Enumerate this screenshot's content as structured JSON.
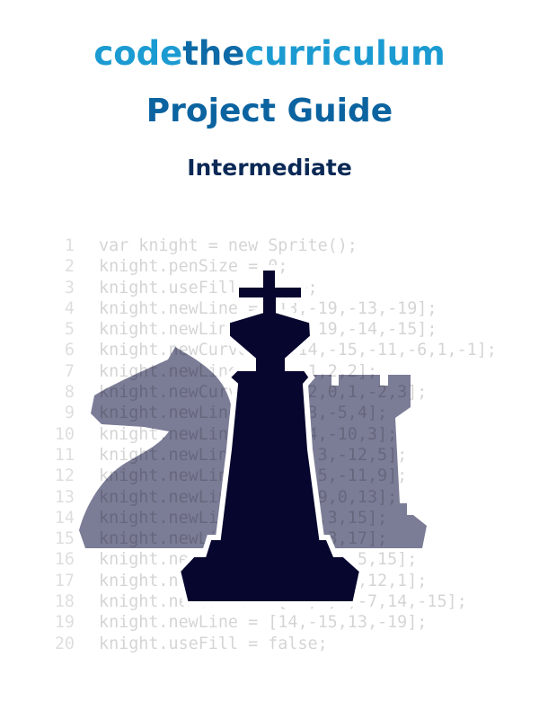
{
  "header": {
    "brand": [
      {
        "text": "code",
        "tone": "light"
      },
      {
        "text": "the",
        "tone": "dark"
      },
      {
        "text": "curriculum",
        "tone": "light"
      }
    ],
    "title": "Project Guide",
    "level": "Intermediate"
  },
  "colors": {
    "brand_light": "#1b9bd1",
    "brand_dark": "#0d6aa6",
    "title": "#0b63a0",
    "level": "#0b2956",
    "piece_grey": "#7b7c96",
    "king": "#07062e"
  },
  "illustration": {
    "pieces": [
      "knight-icon",
      "king-icon",
      "rook-icon"
    ]
  },
  "code": {
    "lines": [
      {
        "n": "1",
        "text": "var knight = new Sprite();"
      },
      {
        "n": "2",
        "text": "knight.penSize = 0;"
      },
      {
        "n": "3",
        "text": "knight.useFill = true;"
      },
      {
        "n": "4",
        "text": "knight.newLine = [13,-19,-13,-19];"
      },
      {
        "n": "5",
        "text": "knight.newLine = [13,-19,-14,-15];"
      },
      {
        "n": "6",
        "text": "knight.newCurve = [-14,-15,-11,-6,1,-1];"
      },
      {
        "n": "7",
        "text": "knight.newLine = [1,-1,2,2];"
      },
      {
        "n": "8",
        "text": "knight.newCurve = [2,2,0,1,-2,3];"
      },
      {
        "n": "9",
        "text": "knight.newLine = [-2,3,-5,4];"
      },
      {
        "n": "10",
        "text": "knight.newLine = [-5,4,-10,3];"
      },
      {
        "n": "11",
        "text": "knight.newLine = [-10,3,-12,5];"
      },
      {
        "n": "12",
        "text": "knight.newLine = [-12,5,-11,9];"
      },
      {
        "n": "13",
        "text": "knight.newLine = [-11,9,0,13];"
      },
      {
        "n": "14",
        "text": "knight.newLine = [0,13,3,15];"
      },
      {
        "n": "15",
        "text": "knight.newLine = [3,15,3,17];"
      },
      {
        "n": "16",
        "text": "knight.newLine = [3,17,16,5,15];"
      },
      {
        "n": "17",
        "text": "knight.newCurve = [16,5,12,12,1];"
      },
      {
        "n": "18",
        "text": "knight.newCurve = [12,1,8,-7,14,-15];"
      },
      {
        "n": "19",
        "text": "knight.newLine = [14,-15,13,-19];"
      },
      {
        "n": "20",
        "text": "knight.useFill = false;"
      }
    ]
  }
}
